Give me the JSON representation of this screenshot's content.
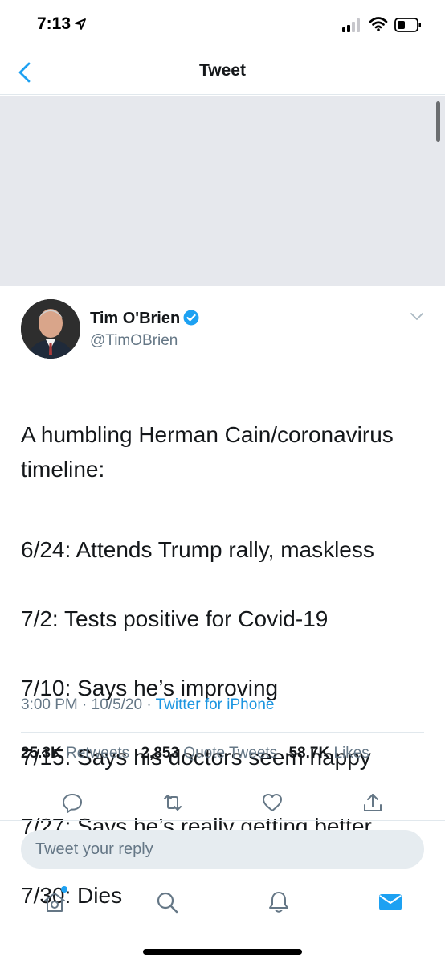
{
  "status_bar": {
    "time": "7:13"
  },
  "nav": {
    "title": "Tweet"
  },
  "tweet": {
    "author_name": "Tim O'Brien",
    "author_handle": "@TimOBrien",
    "text": "A humbling Herman Cain/coronavirus timeline:",
    "timeline": [
      "6/24: Attends Trump rally, maskless",
      "7/2: Tests positive for Covid-19",
      "7/10: Says he’s improving",
      "7/15: Says his doctors seem happy",
      "7/27: Says he’s really getting better",
      "7/30: Dies"
    ],
    "time": "3:00 PM",
    "date": "10/5/20",
    "separator": "·",
    "source": "Twitter for iPhone"
  },
  "stats": {
    "retweets_count": "25.3K",
    "retweets_label": "Retweets",
    "quotes_count": "2,853",
    "quotes_label": "Quote Tweets",
    "likes_count": "58.7K",
    "likes_label": "Likes"
  },
  "reply": {
    "placeholder": "Tweet your reply"
  },
  "icons": {
    "back": "chevron-left-icon",
    "verified": "verified-badge-icon",
    "caret": "chevron-down-icon",
    "reply": "comment-icon",
    "retweet": "retweet-icon",
    "like": "heart-icon",
    "share": "share-icon",
    "home": "home-icon",
    "search": "search-icon",
    "notifications": "bell-icon",
    "messages": "envelope-icon"
  },
  "colors": {
    "accent": "#1da1f2",
    "link": "#1b95e0",
    "secondary_text": "#657786",
    "media_placeholder": "#e6e8ed"
  }
}
